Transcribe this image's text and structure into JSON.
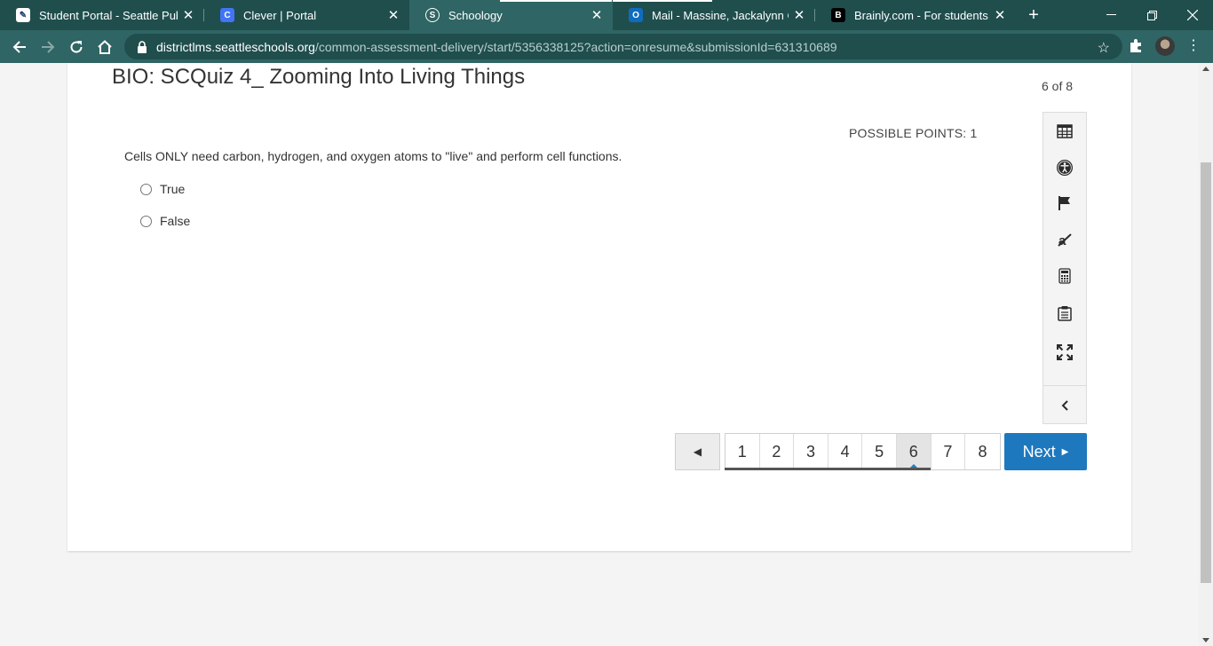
{
  "browser": {
    "tabs": [
      {
        "title": "Student Portal - Seattle Public",
        "favicon": "seattle-schools-icon"
      },
      {
        "title": "Clever | Portal",
        "favicon": "clever-icon"
      },
      {
        "title": "Schoology",
        "favicon": "schoology-icon"
      },
      {
        "title": "Mail - Massine, Jackalynn C - B",
        "favicon": "outlook-icon"
      },
      {
        "title": "Brainly.com - For students. By",
        "favicon": "brainly-icon"
      }
    ],
    "url_domain": "districtlms.seattleschools.org",
    "url_path": "/common-assessment-delivery/start/5356338125?action=onresume&submissionId=631310689"
  },
  "quiz": {
    "title": "BIO: SCQuiz 4_ Zooming Into Living Things",
    "counter": "6 of 8",
    "points": "POSSIBLE POINTS: 1",
    "question": "Cells ONLY need carbon, hydrogen, and oxygen atoms to \"live\" and perform cell functions.",
    "options": [
      "True",
      "False"
    ]
  },
  "tools": [
    "calendar-grid-icon",
    "accessibility-icon",
    "flag-icon",
    "eliminate-icon",
    "calculator-icon",
    "notepad-icon",
    "fullscreen-icon",
    "collapse-chevron-icon"
  ],
  "pager": {
    "pages": [
      "1",
      "2",
      "3",
      "4",
      "5",
      "6",
      "7",
      "8"
    ],
    "current": "6",
    "next_label": "Next"
  },
  "colors": {
    "chrome_dark": "#1f4e4d",
    "chrome_toolbar": "#2f6564",
    "accent_blue": "#1e78be"
  }
}
